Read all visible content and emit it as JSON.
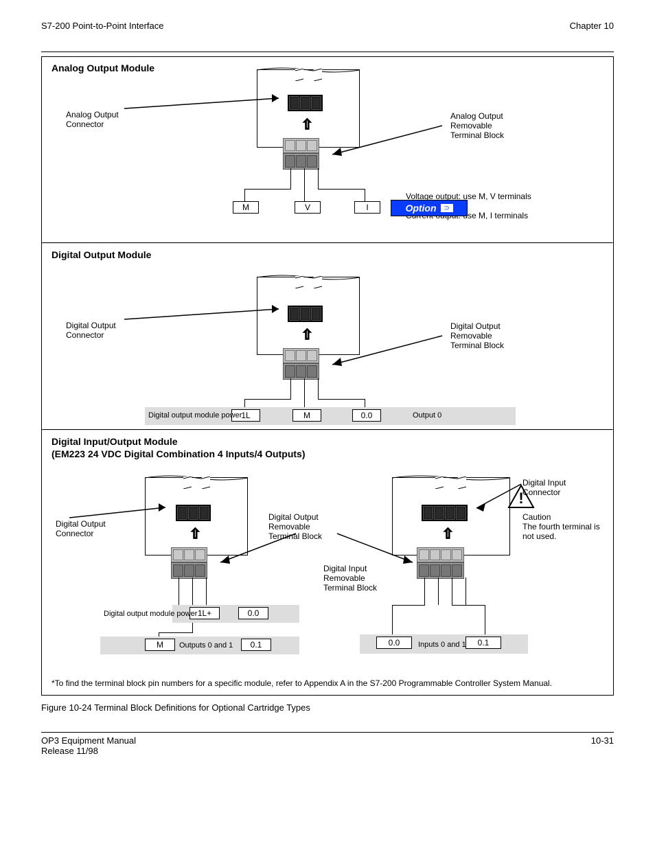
{
  "header": {
    "product_left": "S7-200 Point-to-Point Interface",
    "chapter_right": "Chapter 10"
  },
  "option_badge": {
    "label": "Option"
  },
  "section1": {
    "title": "Analog Output Module",
    "connector_label": "Analog Output\nConnector",
    "plug_label": "Analog Output\nRemovable\nTerminal Block",
    "terminals": [
      "M",
      "V",
      "I"
    ],
    "voltage_note": "Voltage output: use M, V terminals",
    "current_note": "Current output: use M, I terminals"
  },
  "section2": {
    "title": "Digital Output Module",
    "connector_label": "Digital Output\nConnector",
    "plug_label": "Digital Output\nRemovable\nTerminal Block",
    "terminals": [
      "1L",
      "M",
      "0.0"
    ],
    "power_note": "Digital output module power",
    "out_note": "Output 0"
  },
  "section3": {
    "title_line1": "Digital Input/Output Module",
    "title_line2": "(EM223 24 VDC Digital Combination 4 Inputs/4 Outputs)",
    "left": {
      "connector_label": "Digital Output\nConnector",
      "plug_label": "Digital Output\nRemovable\nTerminal Block",
      "terminals_band1": [
        "1L+",
        "0.0"
      ],
      "terminals_band2": [
        "M",
        "0.1"
      ],
      "band1_note": "Digital output module power",
      "band2_note": "Outputs 0 and 1"
    },
    "right": {
      "connector_label": "Digital Input\nConnector",
      "plug_label": "Digital Input\nRemovable\nTerminal Block",
      "terminal_box_left": "0.0",
      "terminal_box_right": "0.1",
      "note": "Inputs 0 and 1",
      "caution_note": "Caution\nThe fourth terminal is not used."
    },
    "footnote": "*To find the terminal block pin numbers for a specific module, refer to Appendix A in the S7-200 Programmable Controller System Manual."
  },
  "figure_caption": "Figure 10-24  Terminal Block Definitions for Optional Cartridge Types",
  "footer": {
    "left": "OP3 Equipment Manual",
    "right": "10-31",
    "release": "Release 11/98"
  }
}
